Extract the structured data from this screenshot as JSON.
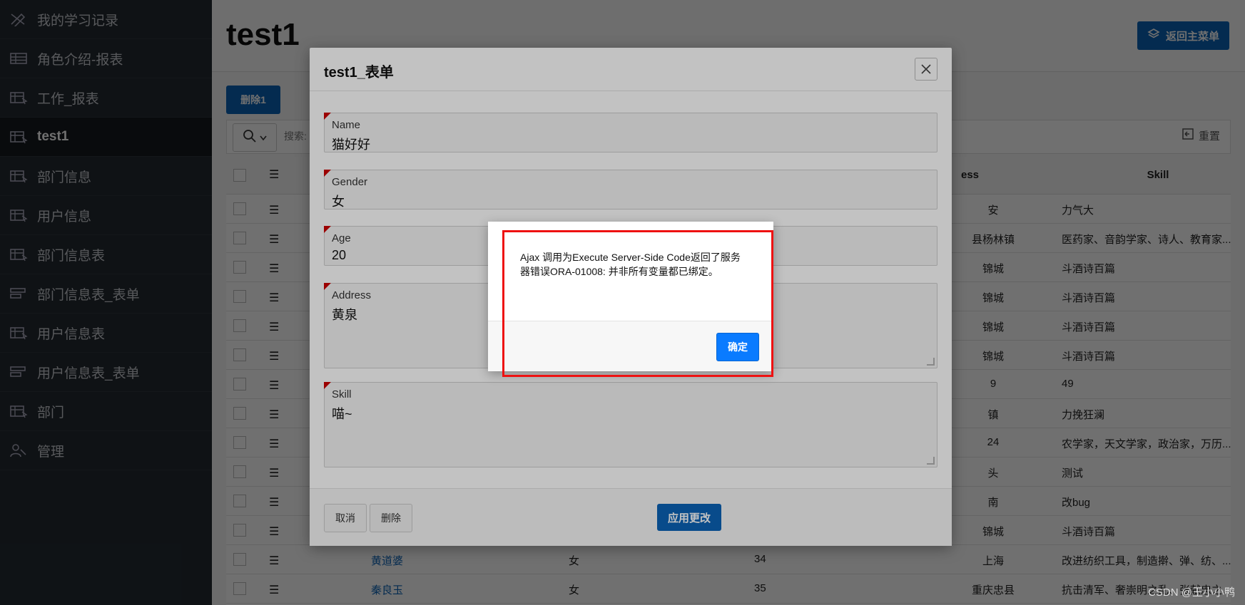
{
  "sidebar": {
    "items": [
      {
        "label": "我的学习记录",
        "icon": "pencil-ruler-icon"
      },
      {
        "label": "角色介绍-报表",
        "icon": "table-icon"
      },
      {
        "label": "工作_报表",
        "icon": "report-icon"
      },
      {
        "label": "test1",
        "icon": "report-icon",
        "active": true
      },
      {
        "label": "部门信息",
        "icon": "report-icon"
      },
      {
        "label": "用户信息",
        "icon": "report-icon"
      },
      {
        "label": "部门信息表",
        "icon": "report-icon"
      },
      {
        "label": "部门信息表_表单",
        "icon": "form-icon"
      },
      {
        "label": "用户信息表",
        "icon": "report-icon"
      },
      {
        "label": "用户信息表_表单",
        "icon": "form-icon"
      },
      {
        "label": "部门",
        "icon": "report-icon"
      },
      {
        "label": "管理",
        "icon": "user-wrench-icon"
      }
    ]
  },
  "page": {
    "title": "test1",
    "back_button": "返回主菜单",
    "delete_button": "删除1",
    "search_placeholder": "搜索:",
    "reset_button": "重置"
  },
  "grid": {
    "headers": {
      "address": "ess",
      "skill": "Skill"
    },
    "rows": [
      {
        "name": "",
        "gender": "",
        "age": "",
        "address": "安",
        "skill": "力气大"
      },
      {
        "name": "",
        "gender": "",
        "age": "",
        "address": "县杨林镇",
        "skill": "医药家、音韵学家、诗人、教育家..."
      },
      {
        "name": "",
        "gender": "",
        "age": "",
        "address": "锦城",
        "skill": "斗酒诗百篇"
      },
      {
        "name": "",
        "gender": "",
        "age": "",
        "address": "锦城",
        "skill": "斗酒诗百篇"
      },
      {
        "name": "",
        "gender": "",
        "age": "",
        "address": "锦城",
        "skill": "斗酒诗百篇"
      },
      {
        "name": "",
        "gender": "",
        "age": "",
        "address": "锦城",
        "skill": "斗酒诗百篇"
      },
      {
        "name": "",
        "gender": "",
        "age": "",
        "address": "9",
        "skill": "49"
      },
      {
        "name": "",
        "gender": "",
        "age": "",
        "address": "镇",
        "skill": "力挽狂澜"
      },
      {
        "name": "",
        "gender": "",
        "age": "",
        "address": "24",
        "skill": "农学家，天文学家，政治家，万历..."
      },
      {
        "name": "",
        "gender": "",
        "age": "",
        "address": "头",
        "skill": "测试"
      },
      {
        "name": "",
        "gender": "",
        "age": "",
        "address": "南",
        "skill": "改bug"
      },
      {
        "name": "",
        "gender": "",
        "age": "",
        "address": "锦城",
        "skill": "斗酒诗百篇"
      },
      {
        "name": "黄道婆",
        "gender": "女",
        "age": "34",
        "address": "上海",
        "skill": "改进纺织工具，制造擀、弹、纺、..."
      },
      {
        "name": "秦良玉",
        "gender": "女",
        "age": "35",
        "address": "重庆忠县",
        "skill": "抗击清军、奢崇明之乱、张献忠之..."
      }
    ]
  },
  "modal": {
    "title": "test1_表单",
    "fields": [
      {
        "label": "Name",
        "value": "猫好好"
      },
      {
        "label": "Gender",
        "value": "女"
      },
      {
        "label": "Age",
        "value": "20"
      },
      {
        "label": "Address",
        "value": "黄泉"
      },
      {
        "label": "Skill",
        "value": "喵~"
      }
    ],
    "cancel_button": "取消",
    "delete_button": "删除",
    "apply_button": "应用更改"
  },
  "alert": {
    "message": "Ajax 调用为Execute Server-Side Code返回了服务器错误ORA-01008: 并非所有变量都已绑定。",
    "ok_button": "确定"
  },
  "watermark": "CSDN @王小小鸭"
}
